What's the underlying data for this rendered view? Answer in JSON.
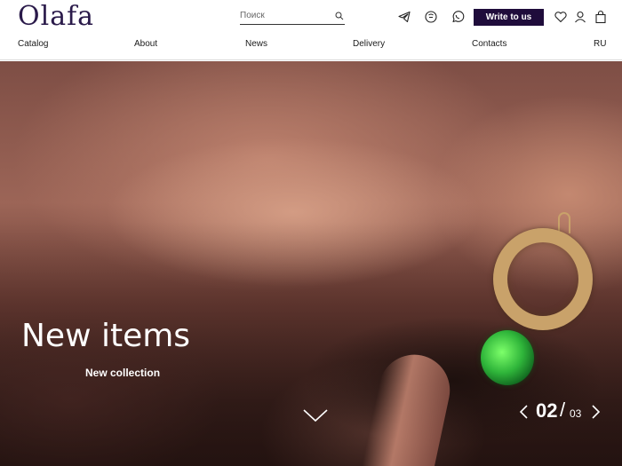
{
  "header": {
    "logo": "Olafa",
    "search": {
      "placeholder": "Поиск"
    },
    "write_button": "Write to us",
    "icons": [
      "telegram-icon",
      "viber-icon",
      "whatsapp-icon",
      "heart-icon",
      "user-icon",
      "bag-icon"
    ],
    "accent_color": "#1f0c3b"
  },
  "nav": {
    "items": [
      "Catalog",
      "About",
      "News",
      "Delivery",
      "Contacts"
    ],
    "language": "RU"
  },
  "hero": {
    "title": "New items",
    "subtitle": "New collection",
    "pager": {
      "current": "02",
      "separator": "/",
      "total": "03"
    }
  }
}
